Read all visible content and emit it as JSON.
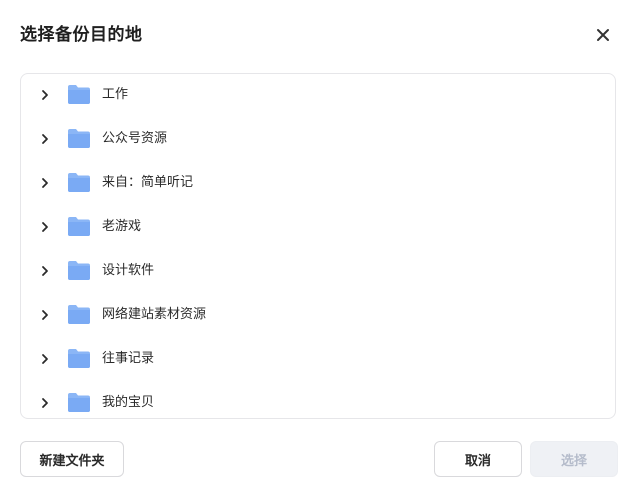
{
  "dialog": {
    "title": "选择备份目的地",
    "close_icon": "close-icon"
  },
  "folders": [
    {
      "label": "工作",
      "icon": "folder-icon"
    },
    {
      "label": "公众号资源",
      "icon": "folder-icon"
    },
    {
      "label": "来自：简单听记",
      "icon": "folder-icon"
    },
    {
      "label": "老游戏",
      "icon": "folder-icon"
    },
    {
      "label": "设计软件",
      "icon": "folder-icon"
    },
    {
      "label": "网络建站素材资源",
      "icon": "folder-icon"
    },
    {
      "label": "往事记录",
      "icon": "folder-icon"
    },
    {
      "label": "我的宝贝",
      "icon": "folder-icon"
    }
  ],
  "footer": {
    "new_folder_label": "新建文件夹",
    "cancel_label": "取消",
    "select_label": "选择"
  },
  "colors": {
    "folder": "#7aaaf4",
    "select_disabled_bg": "#eff1f5",
    "select_disabled_text": "#b5bccb"
  }
}
